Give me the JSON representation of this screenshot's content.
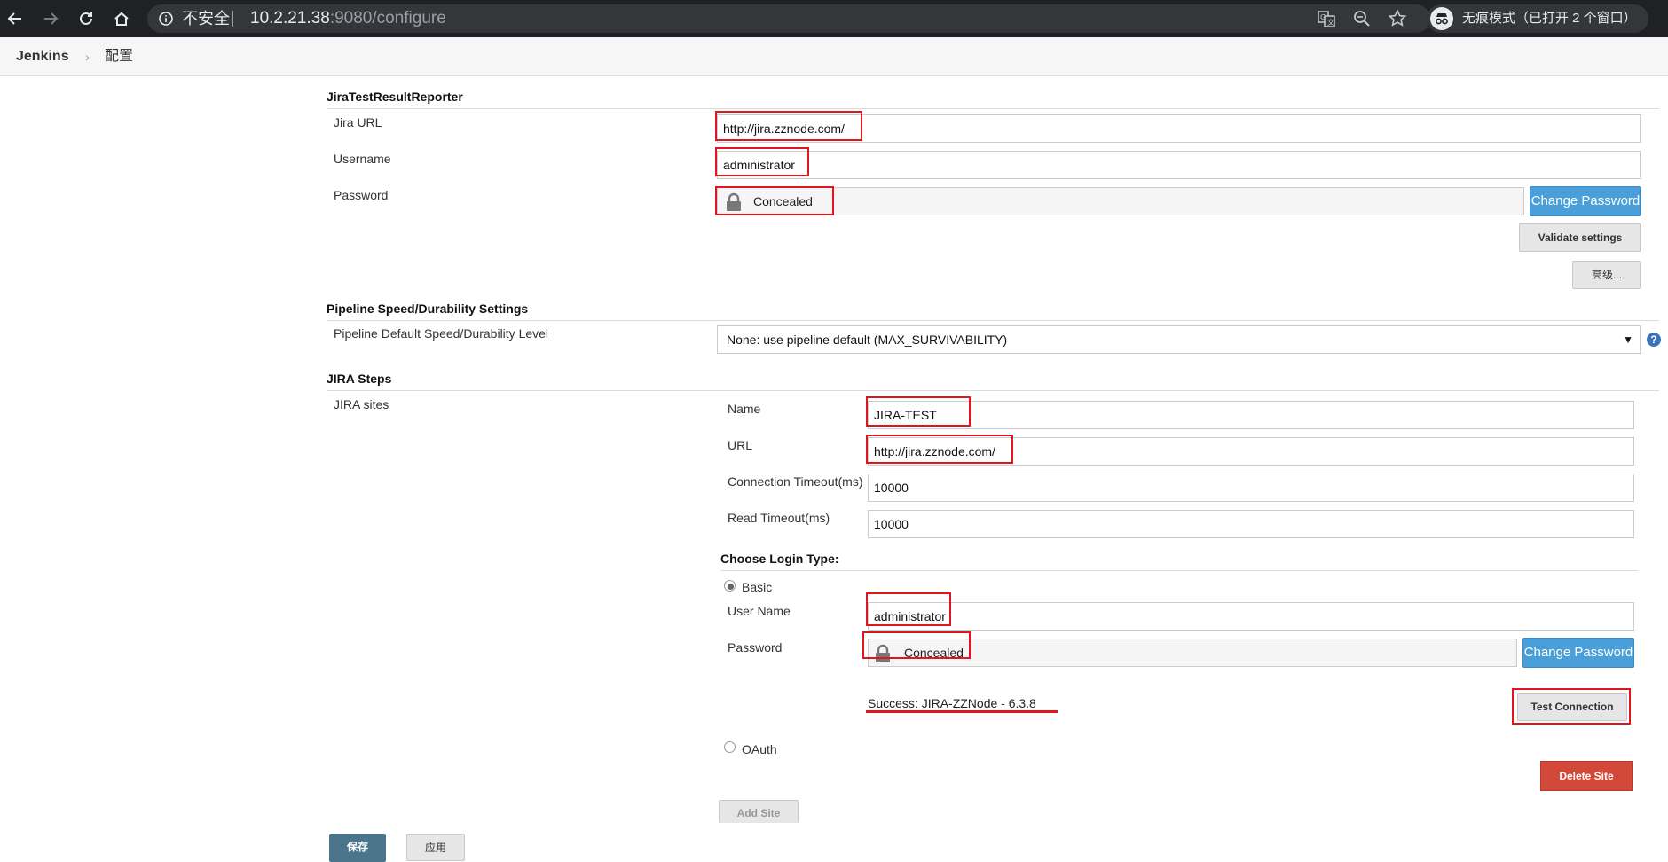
{
  "browser": {
    "security_label": "不安全",
    "url_host": "10.2.21.38",
    "url_rest": ":9080/configure",
    "incognito_label": "无痕模式（已打开 2 个窗口）"
  },
  "breadcrumb": {
    "root": "Jenkins",
    "separator": "›",
    "page": "配置"
  },
  "jira_reporter": {
    "title": "JiraTestResultReporter",
    "jira_url_label": "Jira URL",
    "jira_url_value": "http://jira.zznode.com/",
    "username_label": "Username",
    "username_value": "administrator",
    "password_label": "Password",
    "password_value": "Concealed",
    "change_password": "Change Password",
    "validate_settings": "Validate settings",
    "advanced": "高级..."
  },
  "pipeline": {
    "title": "Pipeline Speed/Durability Settings",
    "level_label": "Pipeline Default Speed/Durability Level",
    "level_value": "None: use pipeline default (MAX_SURVIVABILITY)",
    "help": "?"
  },
  "jira_steps": {
    "title": "JIRA Steps",
    "sites_label": "JIRA sites",
    "name_label": "Name",
    "name_value": "JIRA-TEST",
    "url_label": "URL",
    "url_value": "http://jira.zznode.com/",
    "conn_timeout_label": "Connection Timeout(ms)",
    "conn_timeout_value": "10000",
    "read_timeout_label": "Read Timeout(ms)",
    "read_timeout_value": "10000",
    "login_type_title": "Choose Login Type:",
    "basic_label": "Basic",
    "user_name_label": "User Name",
    "user_name_value": "administrator",
    "password_label": "Password",
    "password_value": "Concealed",
    "change_password": "Change Password",
    "success_message": "Success: JIRA-ZZNode - 6.3.8",
    "test_connection": "Test Connection",
    "oauth_label": "OAuth",
    "delete_site": "Delete Site",
    "add_site": "Add Site"
  },
  "footer": {
    "save": "保存",
    "apply": "应用"
  }
}
